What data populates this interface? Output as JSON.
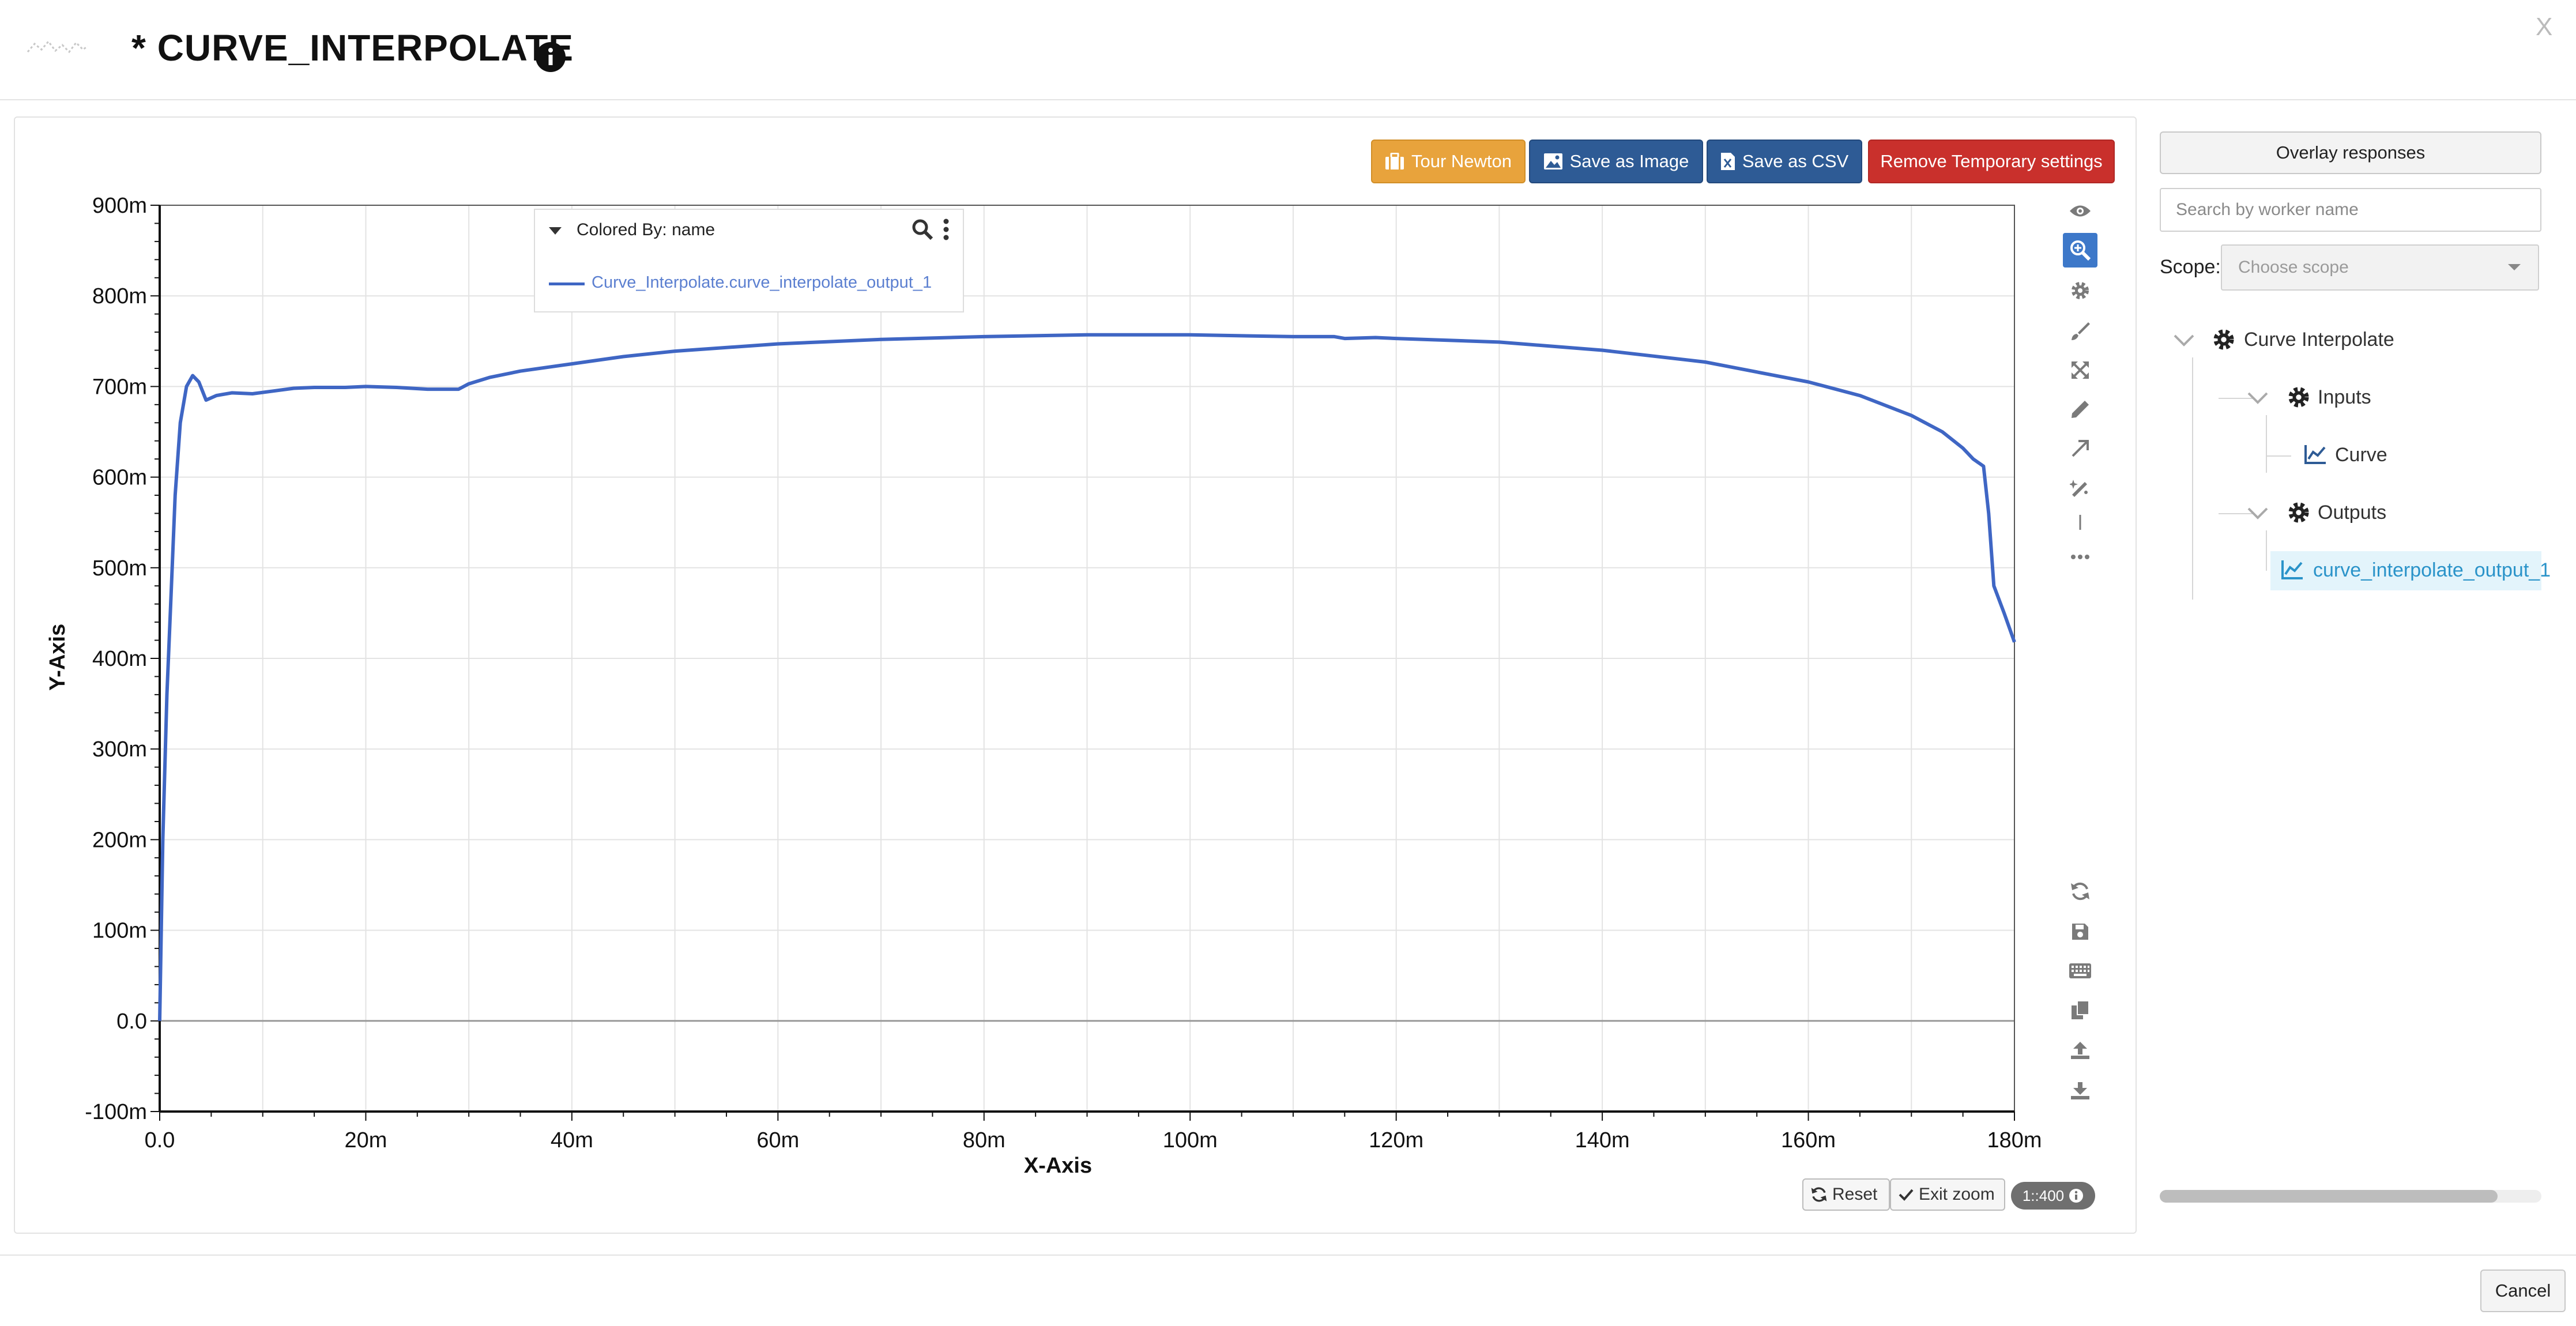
{
  "window": {
    "title": "* CURVE_INTERPOLATE",
    "close_label": "X"
  },
  "toolbar": {
    "tour_label": "Tour Newton",
    "save_image_label": "Save as Image",
    "save_csv_label": "Save as CSV",
    "remove_temp_label": "Remove Temporary settings"
  },
  "legend": {
    "title": "Colored By: name",
    "items": [
      "Curve_Interpolate.curve_interpolate_output_1"
    ]
  },
  "zoom_controls": {
    "reset_label": "Reset",
    "exit_zoom_label": "Exit zoom",
    "scale_label": "1::400"
  },
  "side_tools": [
    "eye-icon",
    "zoom-in-icon",
    "gear-icon",
    "brush-icon",
    "expand-icon",
    "pencil-icon",
    "arrow-icon",
    "magic-icon",
    "line-icon",
    "more-icon"
  ],
  "bottom_tools": [
    "refresh-icon",
    "save-icon",
    "keyboard-icon",
    "copy-icon",
    "upload-icon",
    "download-icon"
  ],
  "sidebar": {
    "overlay_label": "Overlay responses",
    "search_placeholder": "Search by worker name",
    "scope_label": "Scope:",
    "scope_placeholder": "Choose scope",
    "tree": {
      "root": "Curve Interpolate",
      "inputs": "Inputs",
      "input_items": [
        "Curve"
      ],
      "outputs": "Outputs",
      "output_items": [
        "curve_interpolate_output_1"
      ]
    }
  },
  "footer": {
    "cancel_label": "Cancel"
  },
  "colors": {
    "series": "#3f66c4",
    "tour": "#e8a33c",
    "primary": "#2e5b95",
    "danger": "#c9302c",
    "selected": "#e3f4fb",
    "link": "#2a93c9"
  },
  "chart_data": {
    "type": "line",
    "xlabel": "X-Axis",
    "ylabel": "Y-Axis",
    "xlim": [
      0,
      180
    ],
    "ylim": [
      -100,
      900
    ],
    "x_ticks": [
      "0.0",
      "20m",
      "40m",
      "60m",
      "80m",
      "100m",
      "120m",
      "140m",
      "160m",
      "180m"
    ],
    "y_ticks": [
      "-100m",
      "0.0",
      "100m",
      "200m",
      "300m",
      "400m",
      "500m",
      "600m",
      "700m",
      "800m",
      "900m"
    ],
    "grid": true,
    "legend": "top-left",
    "series": [
      {
        "name": "Curve_Interpolate.curve_interpolate_output_1",
        "x": [
          0,
          0.3,
          0.7,
          1.1,
          1.5,
          2,
          2.6,
          3.2,
          3.8,
          4.5,
          5.5,
          7,
          9,
          11,
          13,
          15,
          18,
          20,
          23,
          26,
          29,
          30,
          32,
          35,
          40,
          45,
          50,
          60,
          70,
          80,
          90,
          100,
          110,
          114,
          115,
          118,
          120,
          130,
          140,
          150,
          160,
          165,
          170,
          173,
          175,
          176,
          177,
          177.5,
          178,
          179,
          180
        ],
        "y": [
          0,
          200,
          360,
          470,
          580,
          660,
          700,
          712,
          705,
          685,
          690,
          693,
          692,
          695,
          698,
          699,
          699,
          700,
          699,
          697,
          697,
          703,
          710,
          717,
          725,
          733,
          739,
          747,
          752,
          755,
          757,
          757,
          755,
          755,
          753,
          754,
          753,
          749,
          740,
          727,
          705,
          690,
          668,
          650,
          632,
          620,
          612,
          560,
          480,
          450,
          418
        ]
      }
    ]
  }
}
